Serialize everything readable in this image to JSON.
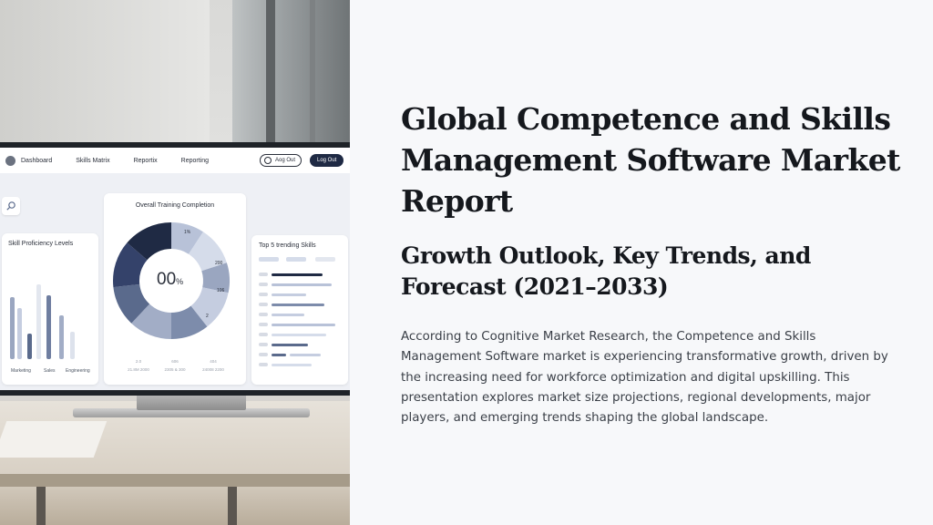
{
  "hero": {
    "title": "Global Competence and Skills Management Software Market Report",
    "subtitle": "Growth Outlook, Key Trends, and Forecast (2021–2033)",
    "body": "According to Cognitive Market Research, the Competence and Skills Management Software market is experiencing transformative growth, driven by the increasing need for workforce optimization and digital upskilling. This presentation explores market size projections, regional developments, major players, and emerging trends shaping the global landscape."
  },
  "dashboard": {
    "nav": {
      "items": [
        "Dashboard",
        "Skills Matrix",
        "Reportix",
        "Reporting"
      ],
      "outline_button": "Aog Out",
      "dark_button": "Log Out"
    },
    "skill_card": {
      "title": "Skill Proficiency Levels",
      "categories": [
        "Marketing",
        "Sales",
        "Engineering"
      ]
    },
    "overall_card": {
      "title": "Overall Training Completion",
      "center_value": "00",
      "center_unit": "%",
      "slice_labels": [
        "1%",
        "200",
        "106",
        "2"
      ],
      "footer": [
        {
          "top": "2.0",
          "bottom": "21.8M 2000"
        },
        {
          "top": "606",
          "bottom": "2305 & 300"
        },
        {
          "top": "404",
          "bottom": "24008 2200"
        }
      ]
    },
    "trend_card": {
      "title": "Top 5 trending Skills"
    },
    "colors": {
      "navy": "#1f2a44",
      "mid": "#5a6a8c",
      "light": "#b8c2d8",
      "pale": "#d5dcea"
    }
  }
}
